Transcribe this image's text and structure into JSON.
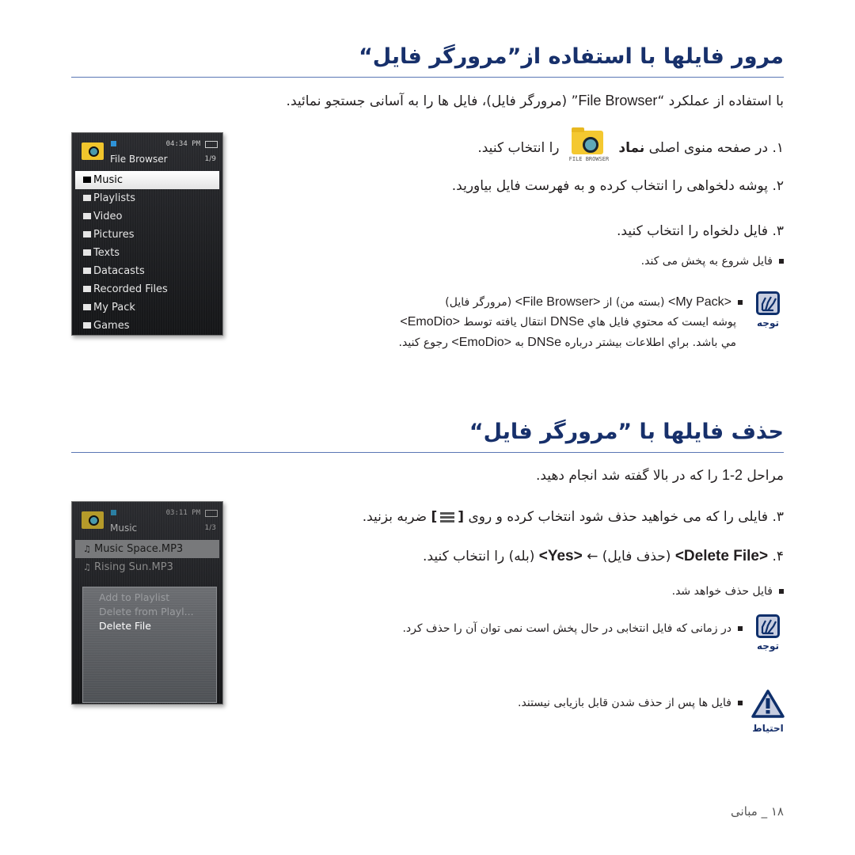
{
  "section1": {
    "title": "مرور فایلها با استفاده از”مرورگر فایل“",
    "intro_pre": "با استفاده از عملکرد “",
    "intro_latin": "File Browser",
    "intro_post": "” (مرورگر فایل)، فایل ها را به آسانی جستجو نمائید.",
    "step1_num": "۱. ",
    "step1_pre": "در صفحه منوی اصلی ",
    "step1_bold": "نماد",
    "step1_post": " را انتخاب کنید.",
    "step1_icon_caption": "FILE BROWSER",
    "step2": "۲. پوشه دلخواهی را انتخاب کرده و به فهرست فایل بیاورید.",
    "step3": "۳. فایل دلخواه را انتخاب کنید.",
    "step3_bullet": "فایل شروع به پخش می کند.",
    "note_label": "توجه",
    "note_line1_parts": [
      "<My Pack>",
      " (بسته من) از ",
      "<File Browser>",
      " (مرورگر فایل)"
    ],
    "note_line2_parts": [
      "پوشه ایست که محتوي فایل هاي ",
      "DNSe",
      " انتقال یافته توسط ",
      "<EmoDio>"
    ],
    "note_line3_parts": [
      "مي باشد. براي اطلاعات بیشتر درباره ",
      "DNSe",
      " به ",
      "<EmoDio>",
      " رجوع کنید."
    ]
  },
  "device1": {
    "time": "04:34 PM",
    "title": "File Browser",
    "page": "1/9",
    "items": [
      {
        "label": "Music",
        "selected": true
      },
      {
        "label": "Playlists",
        "selected": false
      },
      {
        "label": "Video",
        "selected": false
      },
      {
        "label": "Pictures",
        "selected": false
      },
      {
        "label": "Texts",
        "selected": false
      },
      {
        "label": "Datacasts",
        "selected": false
      },
      {
        "label": "Recorded Files",
        "selected": false
      },
      {
        "label": "My Pack",
        "selected": false
      },
      {
        "label": "Games",
        "selected": false
      }
    ]
  },
  "section2": {
    "title": "حذف فایلها با ”مرورگر فایل“",
    "step12_pre": "مراحل ",
    "step12_latin": "1-2",
    "step12_post": " را که در بالا گفته شد انجام دهید.",
    "step3_pre": "۳. فایلی را که می خواهید حذف شود انتخاب کرده و روی ",
    "step3_open": "[",
    "step3_close": "]",
    "step3_post": " ضربه بزنید.",
    "step4_num": "۴. ",
    "step4_delete": "<Delete File>",
    "step4_mid": " (حذف فایل) ← ",
    "step4_yes": "<Yes>",
    "step4_post": " (بله) را انتخاب کنید.",
    "step4_bullet": "فایل حذف خواهد شد.",
    "note_label": "توجه",
    "note_text": "در زمانی که فایل انتخابی در حال پخش است نمی توان آن را حذف کرد.",
    "caution_label": "احتیاط",
    "caution_text": "فایل ها پس از حذف شدن قابل بازیابی نیستند."
  },
  "device2": {
    "time": "03:11 PM",
    "title": "Music",
    "page": "1/3",
    "items": [
      {
        "label": "Music Space.MP3",
        "selected": true
      },
      {
        "label": "Rising Sun.MP3",
        "selected": false
      }
    ],
    "popup": [
      {
        "label": "Add to Playlist",
        "enabled": false
      },
      {
        "label": "Delete from Playl...",
        "enabled": false
      },
      {
        "label": "Delete File",
        "enabled": true
      }
    ]
  },
  "footer": {
    "page_number": "۱۸",
    "separator": " _ ",
    "chapter": "مبانی"
  }
}
